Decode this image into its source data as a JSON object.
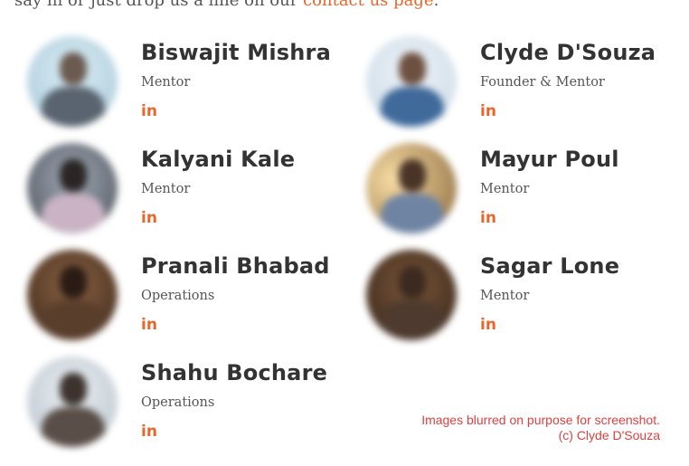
{
  "intro": {
    "text": "say hi or just drop us a line on our ",
    "link_label": "contact us page",
    "end": "."
  },
  "team": [
    {
      "name": "Biswajit Mishra",
      "role": "Mentor",
      "social_label": "in"
    },
    {
      "name": "Clyde D'Souza",
      "role": "Founder & Mentor",
      "social_label": "in"
    },
    {
      "name": "Kalyani Kale",
      "role": "Mentor",
      "social_label": "in"
    },
    {
      "name": "Mayur Poul",
      "role": "Mentor",
      "social_label": "in"
    },
    {
      "name": "Pranali Bhabad",
      "role": "Operations",
      "social_label": "in"
    },
    {
      "name": "Sagar Lone",
      "role": "Mentor",
      "social_label": "in"
    },
    {
      "name": "Shahu Bochare",
      "role": "Operations",
      "social_label": "in"
    }
  ],
  "note": {
    "line1": "Images blurred on purpose for screenshot.",
    "line2": "(c) Clyde D'Souza"
  },
  "colors": {
    "accent": "#e8662b",
    "note": "#e04040",
    "name": "#333333"
  }
}
